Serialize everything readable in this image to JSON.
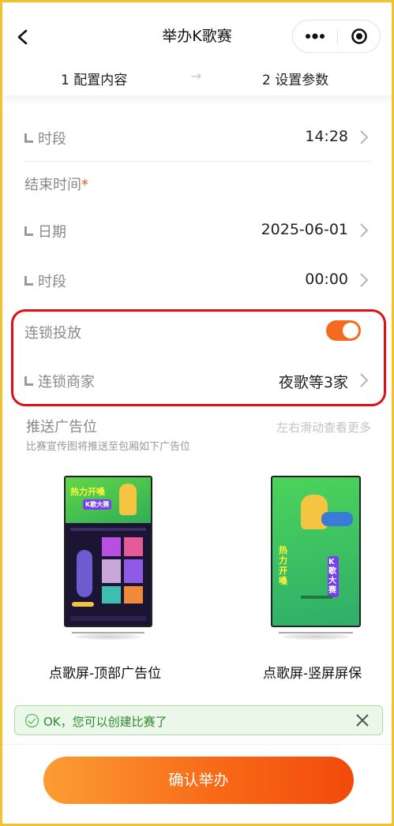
{
  "nav": {
    "title": "举办K歌赛",
    "back_icon": "chevron-left-icon",
    "more_icon": "ellipsis-icon",
    "target_icon": "target-icon"
  },
  "steps": {
    "step1": "1 配置内容",
    "arrow": "→",
    "step2": "2 设置参数"
  },
  "start": {
    "time_label": "时段",
    "time_value": "14:28"
  },
  "end": {
    "section_label": "结束时间",
    "required_mark": "*",
    "date_label": "日期",
    "date_value": "2025-06-01",
    "time_label": "时段",
    "time_value": "00:00"
  },
  "chain": {
    "label": "连锁投放",
    "enabled": true,
    "merchants_label": "连锁商家",
    "merchants_value": "夜歌等3家"
  },
  "ads": {
    "title": "推送广告位",
    "subtitle": "比赛宣传图将推送至包厢如下广告位",
    "hint": "左右滑动查看更多",
    "items": [
      {
        "caption": "点歌屏-顶部广告位",
        "banner_line1": "热力开嗓",
        "banner_line2": "K歌大赛"
      },
      {
        "caption": "点歌屏-竖屏屏保",
        "banner_line1": "热力开嗓",
        "banner_line2": "K歌大赛"
      }
    ]
  },
  "toast": {
    "message": "OK，您可以创建比赛了",
    "icon": "check-circle-icon",
    "close_icon": "close-icon",
    "color": "#3cab3b"
  },
  "confirm": {
    "label": "确认举办"
  },
  "colors": {
    "accent": "#f46a1e",
    "highlight": "#e10f13",
    "frame": "#f2c12e"
  }
}
